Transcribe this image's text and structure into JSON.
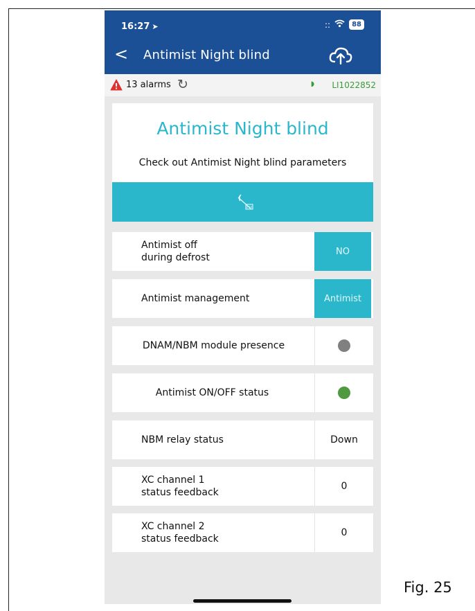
{
  "status_bar": {
    "time": "16:27",
    "location_arrow": "➤",
    "signal": "::",
    "wifi": "wifi-icon",
    "battery": "88"
  },
  "nav": {
    "back": "<",
    "title": "Antimist Night blind",
    "upload_icon": "cloud-upload-icon"
  },
  "alarm_bar": {
    "alarm_text": "13 alarms",
    "device_id": "LI1022852"
  },
  "card": {
    "title": "Antimist Night blind",
    "subtitle": "Check out Antimist Night blind parameters",
    "icon": "night-blind-icon"
  },
  "parameters": [
    {
      "label_line1": "Antimist off",
      "label_line2": "during defrost",
      "value": "NO",
      "type": "button"
    },
    {
      "label_line1": "Antimist management",
      "value": "Antimist",
      "type": "button"
    },
    {
      "label_line1": "DNAM/NBM module presence",
      "type": "indicator",
      "color": "#808080"
    },
    {
      "label_line1": "Antimist ON/OFF status",
      "type": "indicator",
      "color": "#4f9a3e"
    },
    {
      "label_line1": "NBM relay status",
      "value": "Down",
      "type": "text"
    },
    {
      "label_line1": "XC channel 1",
      "label_line2": "status feedback",
      "value": "0",
      "type": "text"
    },
    {
      "label_line1": "XC channel 2",
      "label_line2": "status feedback",
      "value": "0",
      "type": "text"
    }
  ],
  "figure_label": "Fig. 25",
  "colors": {
    "header": "#1b4f96",
    "accent": "#2ab7cc",
    "alarm": "#e03030",
    "device_id": "#3a9a3a"
  }
}
